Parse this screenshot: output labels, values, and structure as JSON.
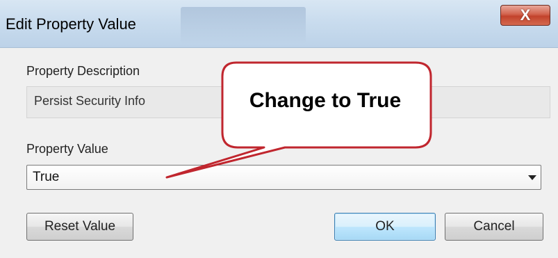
{
  "window": {
    "title": "Edit Property Value",
    "close_label": "X"
  },
  "description": {
    "label": "Property Description",
    "value": "Persist Security Info"
  },
  "property_value": {
    "label": "Property Value",
    "selected": "True"
  },
  "buttons": {
    "reset": "Reset Value",
    "ok": "OK",
    "cancel": "Cancel"
  },
  "annotation": {
    "text": "Change to True",
    "border_color": "#c0262e"
  },
  "colors": {
    "close_button": "#c2432c",
    "titlebar": "#c9dcee",
    "ok_border": "#3c7fb1"
  }
}
